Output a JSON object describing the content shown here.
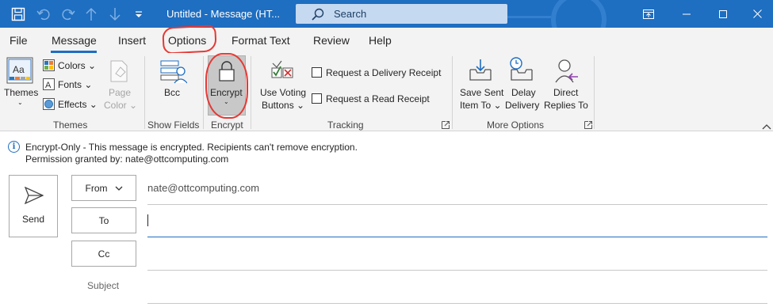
{
  "titlebar": {
    "title": "Untitled  -  Message (HT...",
    "search_placeholder": "Search"
  },
  "tabs": [
    "File",
    "Message",
    "Insert",
    "Options",
    "Format Text",
    "Review",
    "Help"
  ],
  "active_tab": "Message",
  "ribbon": {
    "themes": {
      "themes_label": "Themes",
      "colors_label": "Colors",
      "fonts_label": "Fonts",
      "effects_label": "Effects",
      "page_color_line1": "Page",
      "page_color_line2": "Color",
      "group_label": "Themes"
    },
    "show_fields": {
      "bcc_label": "Bcc",
      "group_label": "Show Fields"
    },
    "encrypt": {
      "encrypt_label": "Encrypt",
      "group_label": "Encrypt"
    },
    "tracking": {
      "voting_line1": "Use Voting",
      "voting_line2": "Buttons",
      "delivery_receipt": "Request a Delivery Receipt",
      "read_receipt": "Request a Read Receipt",
      "group_label": "Tracking"
    },
    "more_options": {
      "save_sent_line1": "Save Sent",
      "save_sent_line2": "Item To",
      "delay_line1": "Delay",
      "delay_line2": "Delivery",
      "direct_line1": "Direct",
      "direct_line2": "Replies To",
      "group_label": "More Options"
    }
  },
  "info": {
    "line1": "Encrypt-Only - This message is encrypted. Recipients can't remove encryption.",
    "line2": "Permission granted by: nate@ottcomputing.com"
  },
  "compose": {
    "send_label": "Send",
    "from_label": "From",
    "from_value": "nate@ottcomputing.com",
    "to_label": "To",
    "cc_label": "Cc",
    "subject_label": "Subject"
  },
  "colors": {
    "titlebar": "#1e6ec1",
    "ribbon_bg": "#f3f3f3",
    "annotation_red": "#e53935"
  }
}
